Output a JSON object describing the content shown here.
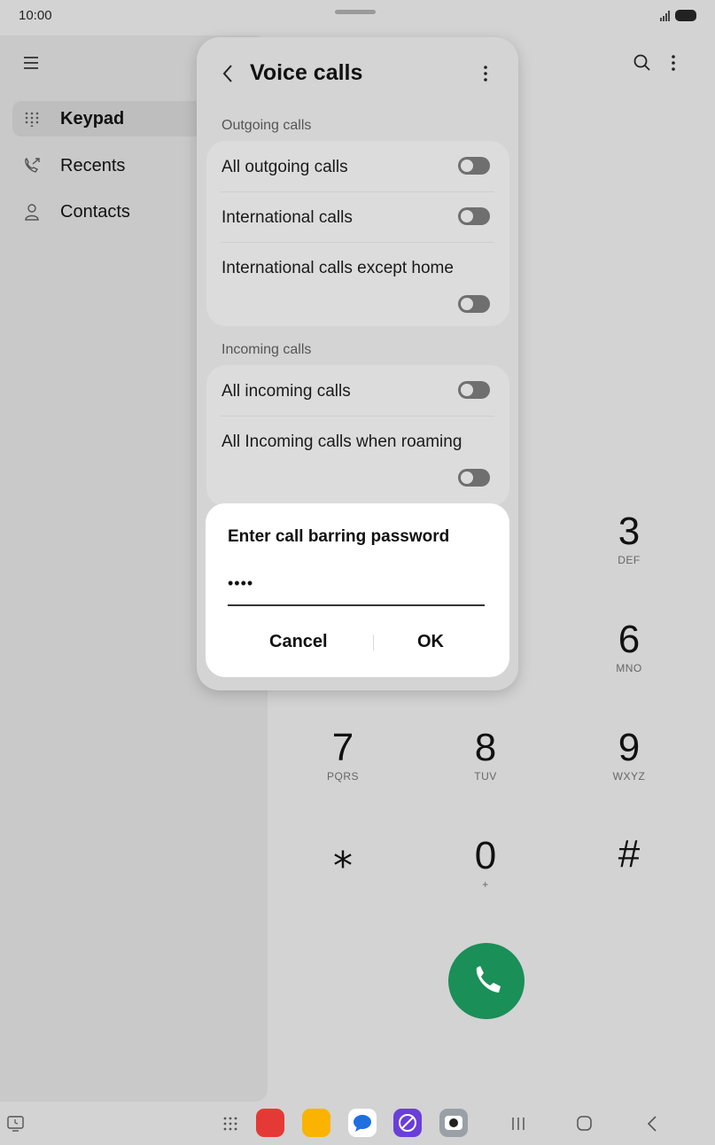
{
  "status": {
    "time": "10:00"
  },
  "sidebar": {
    "items": [
      {
        "label": "Keypad",
        "icon": "dialpad-icon",
        "selected": true
      },
      {
        "label": "Recents",
        "icon": "recents-phone-icon",
        "selected": false
      },
      {
        "label": "Contacts",
        "icon": "person-icon",
        "selected": false
      }
    ]
  },
  "keypad": {
    "keys": [
      {
        "digit": "3",
        "letters": "DEF"
      },
      {
        "digit": "6",
        "letters": "MNO"
      },
      {
        "digit": "7",
        "letters": "PQRS"
      },
      {
        "digit": "8",
        "letters": "TUV"
      },
      {
        "digit": "9",
        "letters": "WXYZ"
      },
      {
        "digit": "⁎",
        "letters": ""
      },
      {
        "digit": "0",
        "letters": "+"
      },
      {
        "digit": "#",
        "letters": ""
      }
    ]
  },
  "panel": {
    "title": "Voice calls",
    "outgoing_label": "Outgoing calls",
    "incoming_label": "Incoming calls",
    "outgoing": [
      {
        "label": "All outgoing calls",
        "on": false
      },
      {
        "label": "International calls",
        "on": false
      },
      {
        "label": "International calls except home",
        "on": false
      }
    ],
    "incoming": [
      {
        "label": "All incoming calls",
        "on": false
      },
      {
        "label": "All Incoming calls when roaming",
        "on": false
      }
    ]
  },
  "dialog": {
    "title": "Enter call barring password",
    "password_masked": "••••",
    "cancel": "Cancel",
    "ok": "OK"
  },
  "colors": {
    "call_button": "#1a8f58",
    "background": "#d3d3d3"
  }
}
